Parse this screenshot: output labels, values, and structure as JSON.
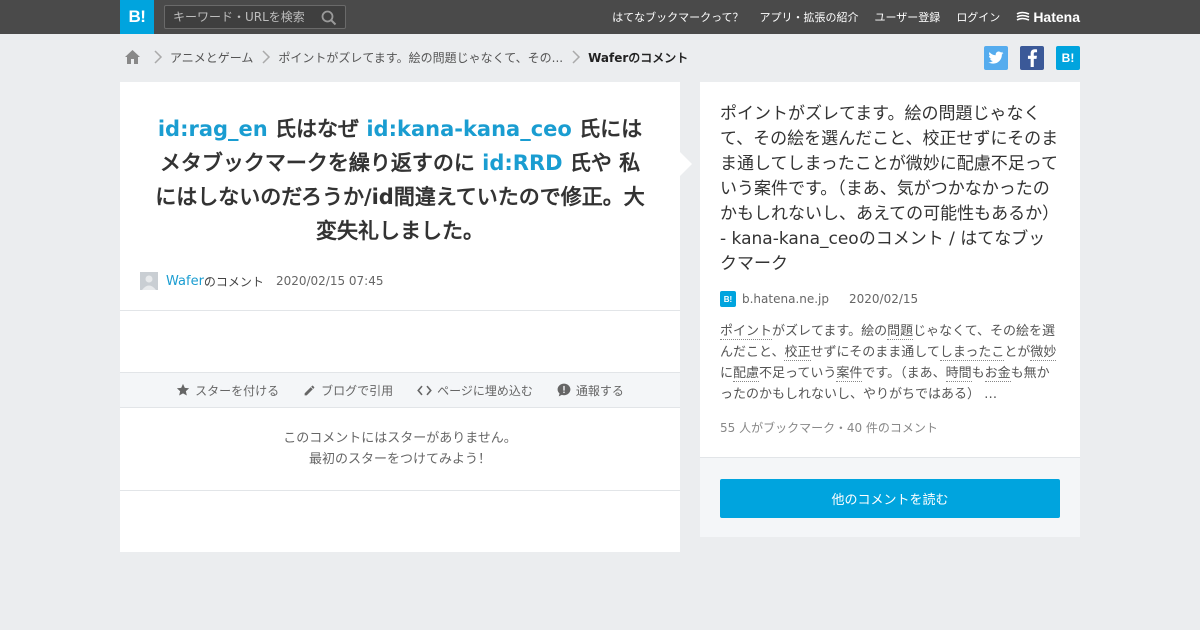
{
  "header": {
    "logo_text": "B!",
    "search_placeholder": "キーワード・URLを検索",
    "nav": [
      "はてなブックマークって？",
      "アプリ・拡張の紹介",
      "ユーザー登録",
      "ログイン"
    ],
    "brand": "Hatena"
  },
  "breadcrumb": {
    "items": [
      "アニメとゲーム",
      "ポイントがズレてます。絵の問題じゃなくて、その..."
    ],
    "current": "Waferのコメント"
  },
  "share": {
    "hatena_label": "B!"
  },
  "comment": {
    "parts": [
      {
        "text": "id:rag_en",
        "link": true
      },
      {
        "text": " 氏はなぜ ",
        "link": false
      },
      {
        "text": "id:kana-kana_ceo",
        "link": true
      },
      {
        "text": " 氏にはメタブックマークを繰り返すのに ",
        "link": false
      },
      {
        "text": "id:RRD",
        "link": true
      },
      {
        "text": " 氏や 私にはしないのだろうか/id間違えていたので修正。大変失礼しました。",
        "link": false
      }
    ],
    "author": "Wafer",
    "author_suffix": "のコメント",
    "date": "2020/02/15 07:45"
  },
  "actions": [
    "スターを付ける",
    "ブログで引用",
    "ページに埋め込む",
    "通報する"
  ],
  "no_stars": {
    "line1": "このコメントにはスターがありません。",
    "line2": "最初のスターをつけてみよう！"
  },
  "entry": {
    "title": "ポイントがズレてます。絵の問題じゃなくて、その絵を選んだこと、校正せずにそのまま通してしまったことが微妙に配慮不足っていう案件です。（まあ、気がつかなかったのかもしれないし、あえての可能性もあるか） - kana-kana_ceoのコメント / はてなブックマーク",
    "favicon": "B!",
    "domain": "b.hatena.ne.jp",
    "date": "2020/02/15",
    "summary": [
      {
        "t": "ポイント",
        "u": true
      },
      {
        "t": "がズレてます。絵の",
        "u": false
      },
      {
        "t": "問題",
        "u": true
      },
      {
        "t": "じゃなくて、その絵を選んだこと、",
        "u": false
      },
      {
        "t": "校正",
        "u": true
      },
      {
        "t": "せずにそのまま通して",
        "u": false
      },
      {
        "t": "しまったこ",
        "u": true
      },
      {
        "t": "とが",
        "u": false
      },
      {
        "t": "微妙",
        "u": true
      },
      {
        "t": "に",
        "u": false
      },
      {
        "t": "配慮",
        "u": true
      },
      {
        "t": "不足っていう",
        "u": false
      },
      {
        "t": "案件",
        "u": true
      },
      {
        "t": "です。（まあ、",
        "u": false
      },
      {
        "t": "時間",
        "u": true
      },
      {
        "t": "も",
        "u": false
      },
      {
        "t": "お金",
        "u": true
      },
      {
        "t": "も無かったのかもしれないし、やりがちではある） …",
        "u": false
      }
    ],
    "stats": "55 人がブックマーク・40 件のコメント",
    "read_more": "他のコメントを読む"
  },
  "colors": {
    "topbar": "#4a4a4a",
    "brand_blue": "#00a4de",
    "link_blue": "#1a9dd1",
    "twitter": "#55acee",
    "facebook": "#3b5998",
    "page_bg": "#ebedef"
  },
  "icons": [
    "search-icon",
    "home-icon",
    "chevron-right-icon",
    "twitter-icon",
    "facebook-icon",
    "hatena-bookmark-icon",
    "star-icon",
    "pencil-icon",
    "code-icon",
    "alert-icon",
    "avatar"
  ]
}
